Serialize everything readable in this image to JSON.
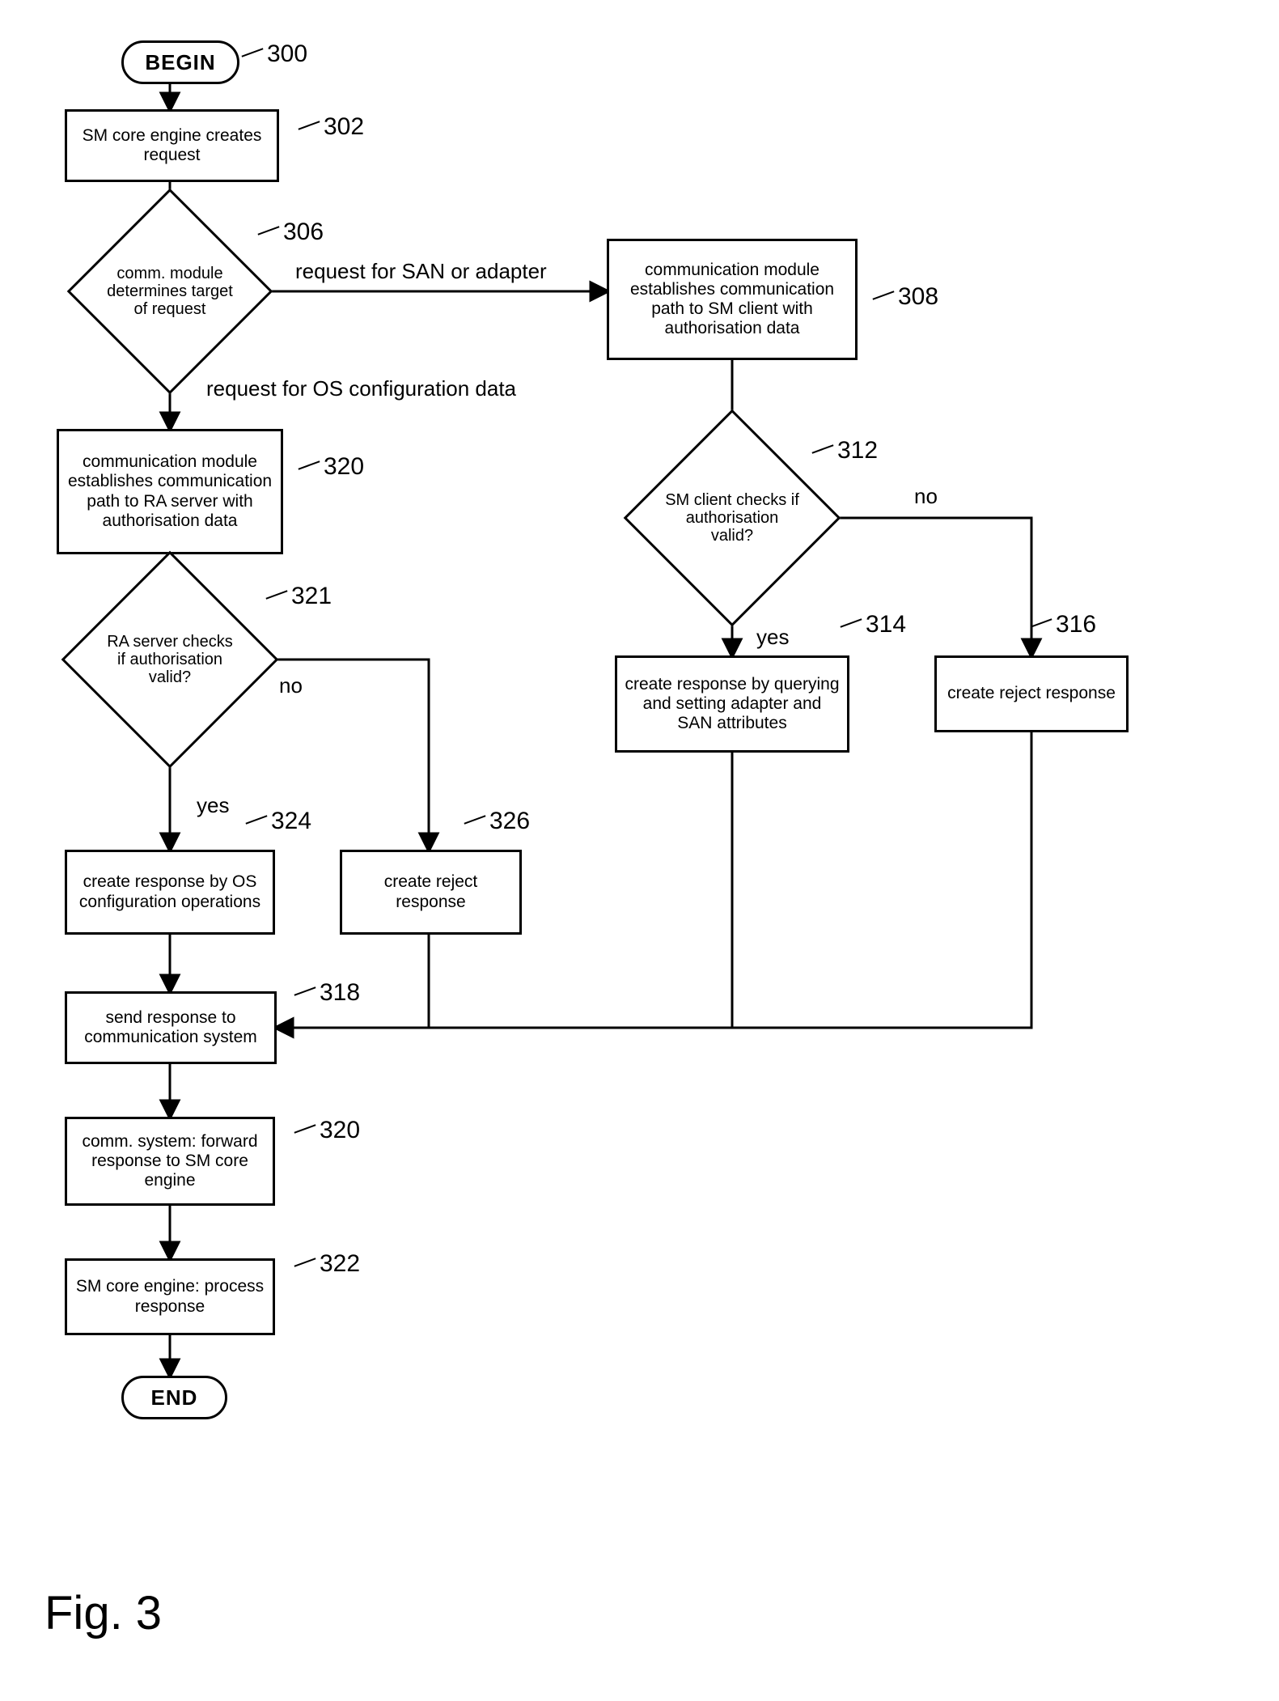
{
  "terminators": {
    "begin": "BEGIN",
    "end": "END"
  },
  "boxes": {
    "b302": "SM core engine creates request",
    "b308": "communication module establishes communication path to SM client with authorisation data",
    "b314": "create response by querying and setting adapter and SAN attributes",
    "b316": "create reject response",
    "b320a": "communication module establishes communication path to RA server with authorisation data",
    "b324": "create response by OS configuration operations",
    "b326": "create reject response",
    "b318": "send response to communication system",
    "b320b": "comm. system: forward response to SM core engine",
    "b322": "SM core engine: process response"
  },
  "diamonds": {
    "d306": "comm. module determines target of request",
    "d312": "SM client checks if authorisation valid?",
    "d321": "RA server checks if authorisation valid?"
  },
  "edgeLabels": {
    "reqSAN": "request for SAN or adapter",
    "reqOS": "request for OS configuration data",
    "yes1": "yes",
    "no1": "no",
    "yes2": "yes",
    "no2": "no"
  },
  "refs": {
    "r300": "300",
    "r302": "302",
    "r306": "306",
    "r308": "308",
    "r312": "312",
    "r314": "314",
    "r316": "316",
    "r320a": "320",
    "r321": "321",
    "r324": "324",
    "r326": "326",
    "r318": "318",
    "r320b": "320",
    "r322": "322"
  },
  "figure": "Fig. 3"
}
